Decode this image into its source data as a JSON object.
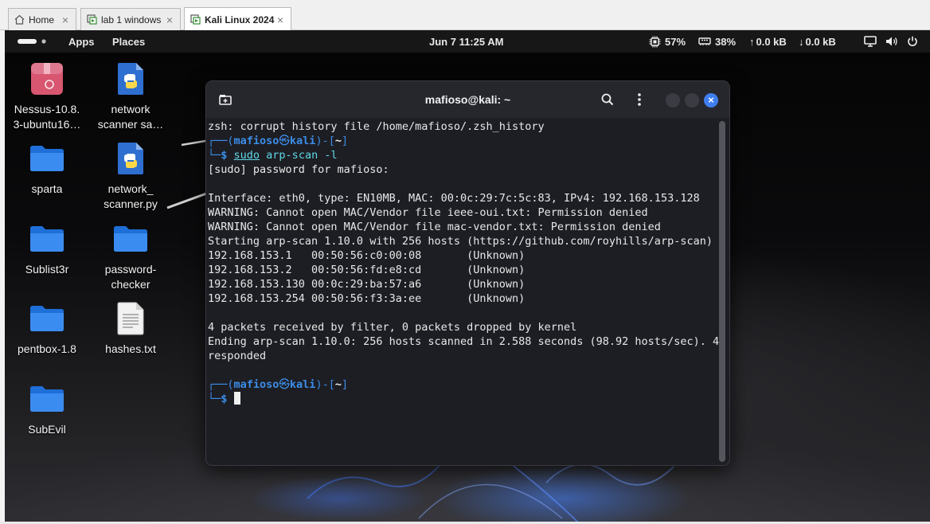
{
  "browser_tabs": [
    {
      "label": "Home",
      "icon": "home-icon"
    },
    {
      "label": "lab 1 windows",
      "icon": "vm-icon"
    },
    {
      "label": "Kali Linux 2024",
      "icon": "vm-icon",
      "active": true
    }
  ],
  "panel": {
    "apps": "Apps",
    "places": "Places",
    "datetime": "Jun 7  11:25 AM",
    "cpu": "57%",
    "memory": "38%",
    "upload": "0.0 kB",
    "download": "0.0 kB"
  },
  "desktop_icons": [
    {
      "label": "Nessus-10.8.\n3-ubuntu16…",
      "icon": "debian-package-icon"
    },
    {
      "label": "network\nscanner sa…",
      "icon": "python-file-icon"
    },
    {
      "label": "sparta",
      "icon": "folder-icon"
    },
    {
      "label": "network_\nscanner.py",
      "icon": "python-file-icon"
    },
    {
      "label": "Sublist3r",
      "icon": "folder-icon"
    },
    {
      "label": "password-\nchecker",
      "icon": "folder-icon"
    },
    {
      "label": "pentbox-1.8",
      "icon": "folder-icon"
    },
    {
      "label": "hashes.txt",
      "icon": "text-file-icon"
    },
    {
      "label": "SubEvil",
      "icon": "folder-icon"
    }
  ],
  "terminal": {
    "title": "mafioso@kali: ~",
    "prompt": {
      "user": "mafioso",
      "host": "kali",
      "path": "~"
    },
    "line_history": "zsh: corrupt history file /home/mafioso/.zsh_history",
    "command_sudo": "sudo",
    "command_rest": " arp-scan -l",
    "output": [
      "[sudo] password for mafioso:",
      "",
      "Interface: eth0, type: EN10MB, MAC: 00:0c:29:7c:5c:83, IPv4: 192.168.153.128",
      "WARNING: Cannot open MAC/Vendor file ieee-oui.txt: Permission denied",
      "WARNING: Cannot open MAC/Vendor file mac-vendor.txt: Permission denied",
      "Starting arp-scan 1.10.0 with 256 hosts (https://github.com/royhills/arp-scan)",
      "192.168.153.1   00:50:56:c0:00:08       (Unknown)",
      "192.168.153.2   00:50:56:fd:e8:cd       (Unknown)",
      "192.168.153.130 00:0c:29:ba:57:a6       (Unknown)",
      "192.168.153.254 00:50:56:f3:3a:ee       (Unknown)",
      "",
      "4 packets received by filter, 0 packets dropped by kernel",
      "Ending arp-scan 1.10.0: 256 hosts scanned in 2.588 seconds (98.92 hosts/sec). 4",
      "responded",
      ""
    ]
  }
}
